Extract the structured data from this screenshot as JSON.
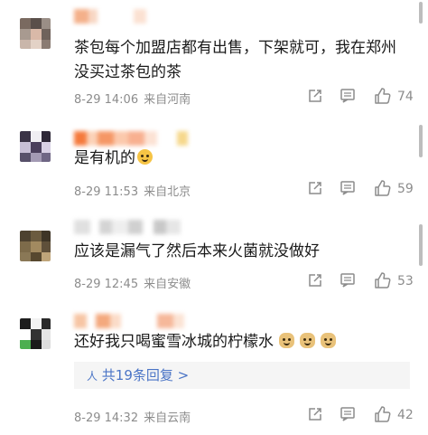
{
  "comments": [
    {
      "text": "茶包每个加盟店都有出售，下架就可，我在郑州没买过茶包的茶",
      "time": "8-29 14:06",
      "location": "来自河南",
      "likes": "74"
    },
    {
      "text": "是有机的",
      "time": "8-29 11:53",
      "location": "来自北京",
      "likes": "59"
    },
    {
      "text": "应该是漏气了然后本来火菌就没做好",
      "time": "8-29 12:45",
      "location": "来自安徽",
      "likes": "53"
    },
    {
      "text": "还好我只喝蜜雪冰城的柠檬水",
      "time": "8-29 14:32",
      "location": "来自云南",
      "likes": "42",
      "replies_label": "共19条回复 >"
    }
  ],
  "colors": {
    "link": "#4a74c6",
    "meta": "#8c8c8c",
    "text": "#1a1a1a"
  }
}
